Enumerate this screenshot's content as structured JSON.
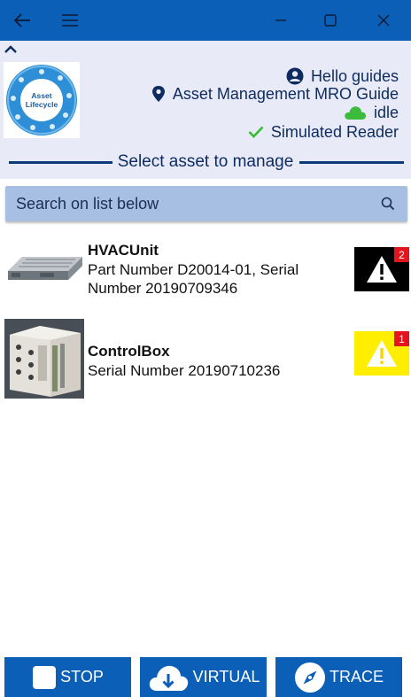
{
  "window": {
    "icons": {
      "back": "arrow-left-icon",
      "menu": "hamburger-menu-icon",
      "minimize": "minimize-icon",
      "maximize": "maximize-icon",
      "close": "close-icon"
    }
  },
  "header": {
    "logo_text_line1": "Asset",
    "logo_text_line2": "Lifecycle",
    "user_greeting": "Hello guides",
    "guide_name": "Asset Management MRO Guide",
    "status": "idle",
    "reader": "Simulated Reader",
    "section_title": "Select asset to manage"
  },
  "search": {
    "placeholder": "Search on list below"
  },
  "assets": [
    {
      "name": "HVACUnit",
      "detail": "Part Number D20014-01, Serial Number 20190709346",
      "alert_count": "2",
      "alert_color": "#000000"
    },
    {
      "name": "ControlBox",
      "detail": "Serial Number 20190710236",
      "alert_count": "1",
      "alert_color": "#ffee00"
    }
  ],
  "buttons": {
    "stop": "STOP",
    "virtual": "VIRTUAL",
    "trace": "TRACE"
  },
  "colors": {
    "primary": "#0b5fb6",
    "header_bg": "#e8eaf8",
    "search_bg": "#a6bfe2",
    "idle_cloud": "#3dbb3d",
    "check": "#2fbf2f",
    "alert_count_bg": "#e3141e"
  }
}
